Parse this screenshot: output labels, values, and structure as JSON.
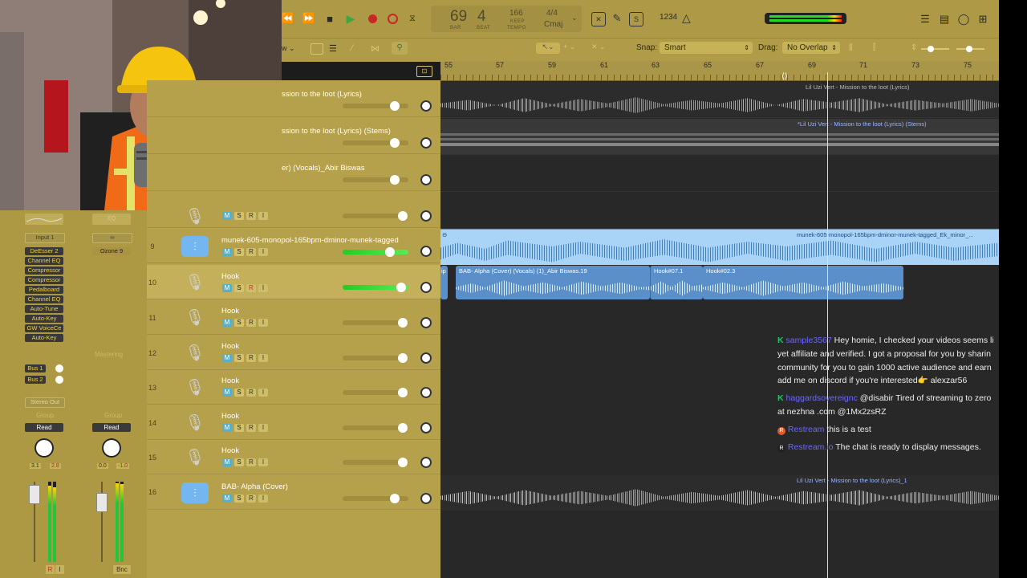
{
  "transport": {
    "lcd_bar": "69",
    "lcd_beat": "4",
    "lcd_bar_label": "BAR",
    "lcd_beat_label": "BEAT",
    "tempo": "166",
    "tempo_label_keep": "KEEP",
    "tempo_label": "TEMPO",
    "time_sig": "4/4",
    "key": "Cmaj",
    "count_in": "1234"
  },
  "subbar": {
    "snap_label": "Snap:",
    "snap_value": "Smart",
    "drag_label": "Drag:",
    "drag_value": "No Overlap"
  },
  "ruler_bars": [
    "55",
    "57",
    "59",
    "61",
    "63",
    "65",
    "67",
    "69",
    "71",
    "73",
    "75"
  ],
  "inspector": {
    "input_label": "Input 1",
    "link_label": "∞",
    "ozone_label": "Ozone 9",
    "plugins": [
      "DeEsser 2",
      "Channel EQ",
      "Compressor",
      "Compressor",
      "Pedalboard",
      "Channel EQ",
      "Auto-Tune",
      "Auto-Key",
      "GW VoiceCe",
      "Auto-Key"
    ],
    "eq_label": "EQ",
    "mastering_label": "Mastering",
    "bus1": "Bus 1",
    "bus2": "Bus 2",
    "stereo_out": "Stereo Out",
    "group1": "Group",
    "group2": "Group",
    "read1": "Read",
    "read2": "Read",
    "val1a": "3.1",
    "val1b": "2.8",
    "val2a": "0.0",
    "val2b": "-1.0",
    "r_btn": "R",
    "i_btn": "I",
    "bnc_btn": "Bnc"
  },
  "tracks": [
    {
      "num": "",
      "name": "ssion to the loot (Lyrics)"
    },
    {
      "num": "",
      "name": "ssion to the loot (Lyrics) (Stems)"
    },
    {
      "num": "",
      "name": "er) (Vocals)_Abir Biswas"
    },
    {
      "num": "",
      "name": ""
    },
    {
      "num": "9",
      "name": "munek-605-monopol-165bpm-dminor-munek-tagged"
    },
    {
      "num": "10",
      "name": "Hook"
    },
    {
      "num": "11",
      "name": "Hook"
    },
    {
      "num": "12",
      "name": "Hook"
    },
    {
      "num": "13",
      "name": "Hook"
    },
    {
      "num": "14",
      "name": "Hook"
    },
    {
      "num": "15",
      "name": "Hook"
    },
    {
      "num": "16",
      "name": "BAB- Alpha (Cover)"
    }
  ],
  "msri": {
    "m": "M",
    "s": "S",
    "r": "R",
    "i": "I"
  },
  "regions": {
    "r1": "Lil Uzi Vert - Mission to the loot (Lyrics)",
    "r2": "*Lil Uzi Vert - Mission to the loot (Lyrics) (Stems)",
    "r3": "munek-605-monopol-165bpm-dminor-munek-tagged_Ek_minor_...",
    "r4a": "ip",
    "r4b": "BAB- Alpha (Cover) (Vocals) (1)_Abir Biswas.19",
    "r4c": "Hook#07.1",
    "r4d": "Hook#02.3",
    "r5": "Lil Uzi Vert - Mission to the loot (Lyrics)_1",
    "r3_left": "⊖"
  },
  "chat": [
    {
      "user": "sample3567",
      "text": "Hey homie, I checked your videos seems li",
      "badge_color": "#22c55e"
    },
    {
      "user": "",
      "text": "yet affiliate and verified. I got a proposal for you by sharin"
    },
    {
      "user": "",
      "text": "community for you to gain 1000 active audience and earn"
    },
    {
      "user": "",
      "text": "add me on discord if you're interested👉 alexzar56"
    },
    {
      "user": "haggardsovereignc",
      "text": "@disabir Tired of streaming to zero",
      "badge_color": "#22c55e"
    },
    {
      "user": "",
      "text": "at nezhna .com @1Mx2zsRZ"
    },
    {
      "user": "Restream",
      "text": "this is a test",
      "badge_color": "#e05a2a"
    },
    {
      "user": "Restream.io",
      "text": "The chat is ready to display messages.",
      "badge_color": "#222222"
    }
  ]
}
